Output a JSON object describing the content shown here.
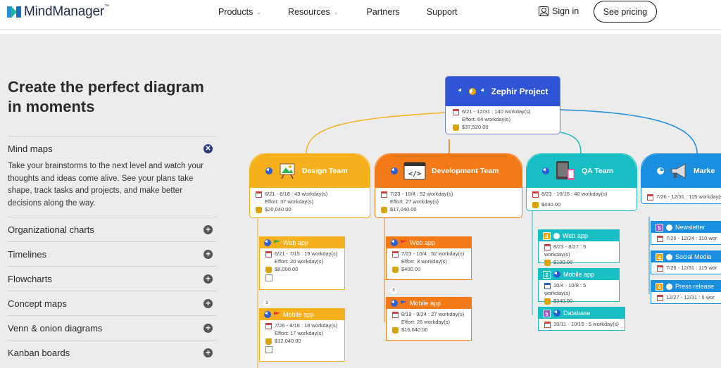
{
  "header": {
    "brand": "MindManager",
    "brand_tm": "™",
    "nav": [
      {
        "label": "Products",
        "has_menu": true
      },
      {
        "label": "Resources",
        "has_menu": true
      },
      {
        "label": "Partners",
        "has_menu": false
      },
      {
        "label": "Support",
        "has_menu": false
      }
    ],
    "signin": "Sign in",
    "pricing": "See pricing"
  },
  "hero": {
    "title": "Create the perfect diagram in moments"
  },
  "accordion": {
    "open_item": "Mind maps",
    "open_desc": "Take your brainstorms to the next level and watch your thoughts and ideas come alive. See your plans take shape, track tasks and projects, and make better decisions along the way.",
    "items": [
      "Organizational charts",
      "Timelines",
      "Flowcharts",
      "Concept maps",
      "Venn & onion diagrams",
      "Kanban boards"
    ]
  },
  "diagram": {
    "root": {
      "title": "Zephir Project",
      "dates": "6/21 - 12/31 : 140 workday(s)",
      "effort": "Effort: 64 workday(s)",
      "cost": "$37,520.00"
    },
    "teams": [
      {
        "title": "Design Team",
        "color": "#f5b01c",
        "dates": "6/21 - 8/18 : 43 workday(s)",
        "effort": "Effort: 37 workday(s)",
        "cost": "$20,040.00"
      },
      {
        "title": "Development Team",
        "color": "#f47a17",
        "dates": "7/23 - 10/4 : 52 workday(s)",
        "effort": "Effort: 27 workday(s)",
        "cost": "$17,040.00"
      },
      {
        "title": "QA Team",
        "color": "#17bfc4",
        "dates": "8/23 - 10/15 : 40 workday(s)",
        "cost": "$440.00"
      },
      {
        "title": "Marke",
        "color": "#1a8fe0",
        "dates": "7/26 - 12/31 : 115 workday(s)"
      }
    ],
    "design_tasks": [
      {
        "label": "Web app",
        "dates": "6/21 - 7/15 : 19 workday(s)",
        "effort": "Effort: 20 workday(s)",
        "cost": "$8,000.00"
      },
      {
        "label": "Mobile app",
        "dates": "7/26 - 8/18 : 18 workday(s)",
        "effort": "Effort: 17 workday(s)",
        "cost": "$12,040.00"
      }
    ],
    "dev_tasks": [
      {
        "label": "Web app",
        "dates": "7/23 - 10/4 : 52 workday(s)",
        "effort": "Effort: 3 workday(s)",
        "cost": "$400.00"
      },
      {
        "label": "Mobile app",
        "dates": "8/19 - 9/24 : 27 workday(s)",
        "effort": "Effort: 26 workday(s)",
        "cost": "$16,640.00"
      }
    ],
    "qa_tasks": [
      {
        "num": "4",
        "label": "Web app",
        "dates": "8/23 - 8/27 : 5 workday(s)",
        "cost": "$100.00"
      },
      {
        "num": "2",
        "label": "Mobile app",
        "dates": "10/4 - 10/8 : 5 workday(s)",
        "cost": "$340.00"
      },
      {
        "num": "5",
        "label": "Database",
        "dates": "10/11 - 10/15 : 5 workday(s)"
      }
    ],
    "mk_tasks": [
      {
        "num": "5",
        "label": "Newsletter",
        "dates": "7/26 - 12/24 : 110 wor"
      },
      {
        "num": "4",
        "label": "Social Media",
        "dates": "7/26 - 12/31 : 115 wor"
      },
      {
        "num": "4",
        "label": "Press release",
        "dates": "12/27 - 12/31 : 5 wor"
      }
    ],
    "sub_count": "3"
  }
}
